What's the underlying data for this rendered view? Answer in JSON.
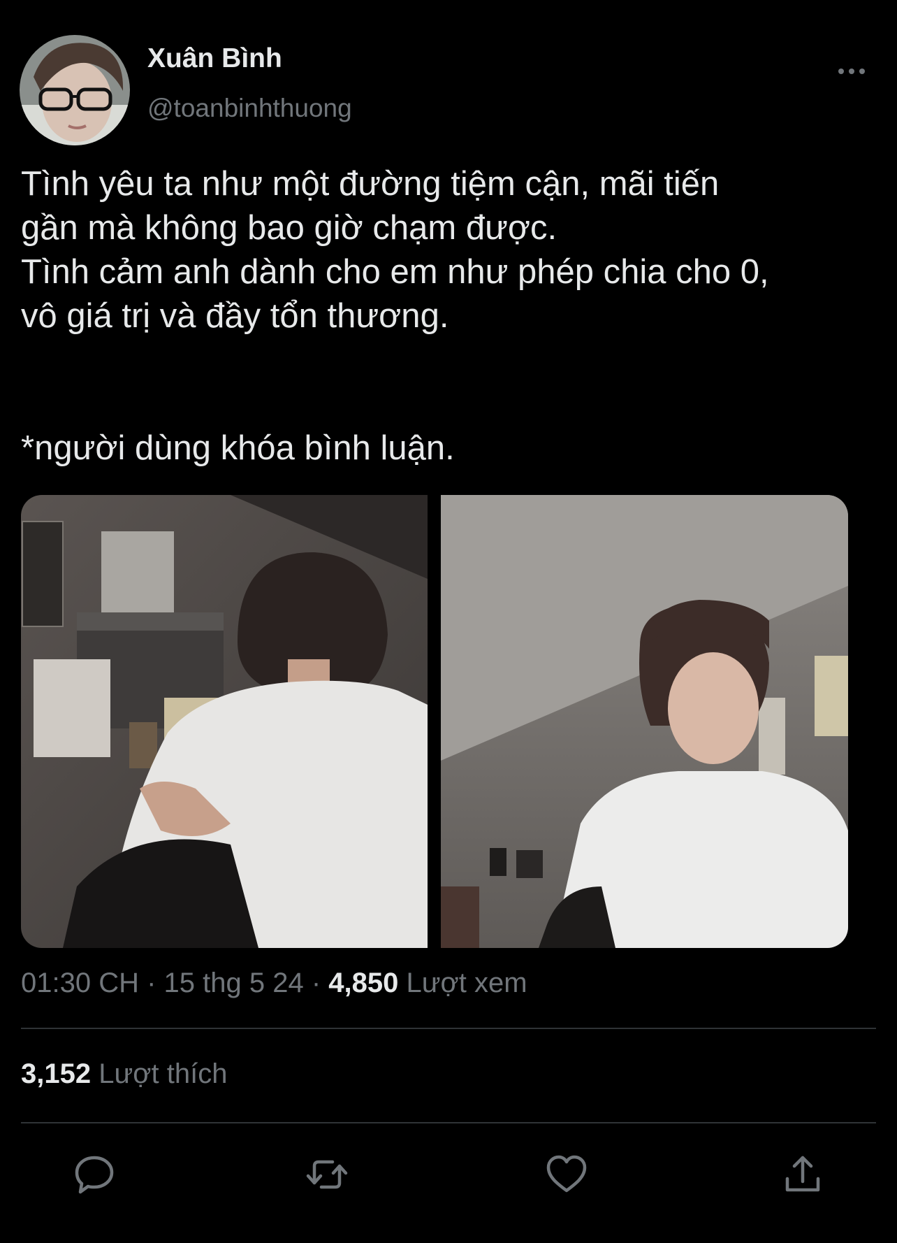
{
  "author": {
    "display_name": "Xuân Bình",
    "handle": "@toanbinhthuong"
  },
  "tweet": {
    "lines": [
      "Tình yêu ta như một đường tiệm cận, mãi tiến",
      "gần mà không bao giờ chạm được.",
      "Tình cảm anh dành cho em như phép chia cho 0,",
      "vô giá trị và đầy tổn thương.",
      "",
      "",
      "*người dùng khóa bình luận."
    ]
  },
  "meta": {
    "time": "01:30 CH",
    "separator": " · ",
    "date": "15 thg 5 24",
    "views_count": "4,850",
    "views_label": "Lượt xem"
  },
  "stats": {
    "likes_count": "3,152",
    "likes_label": "Lượt thích"
  },
  "icons": {
    "more": "more-horizontal-icon",
    "reply": "reply-icon",
    "retweet": "retweet-icon",
    "like": "heart-icon",
    "share": "share-icon"
  },
  "colors": {
    "background": "#000000",
    "text_primary": "#e7e9ea",
    "text_secondary": "#71767b",
    "divider": "#2f3336"
  }
}
